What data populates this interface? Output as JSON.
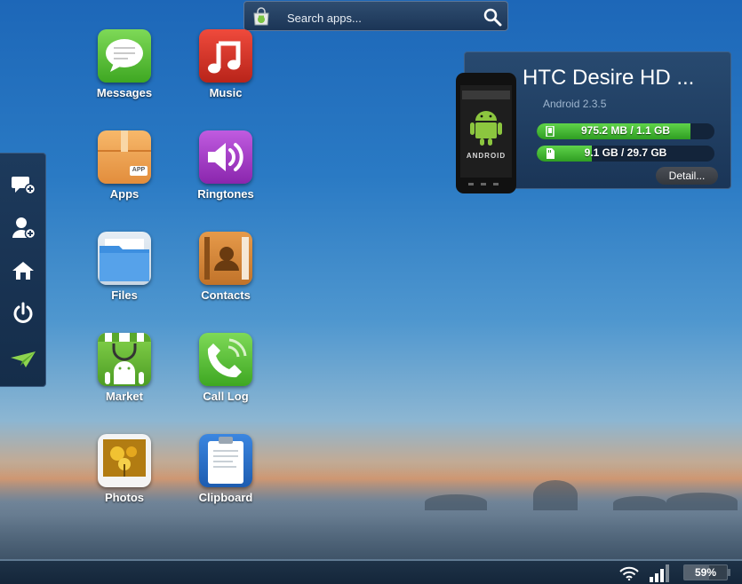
{
  "search": {
    "placeholder": "Search apps..."
  },
  "toolbar": {
    "items": [
      {
        "icon": "new-message-icon"
      },
      {
        "icon": "add-contact-icon"
      },
      {
        "icon": "home-icon"
      },
      {
        "icon": "power-icon"
      },
      {
        "icon": "paper-plane-icon"
      }
    ]
  },
  "apps": [
    {
      "label": "Messages",
      "icon": "messages-icon",
      "color": "#5cc43b"
    },
    {
      "label": "Music",
      "icon": "music-icon",
      "color": "#d8362b"
    },
    {
      "label": "Apps",
      "icon": "apps-icon",
      "color": "#f0a55a",
      "badge": "APP"
    },
    {
      "label": "Ringtones",
      "icon": "ringtones-icon",
      "color": "#a640c9"
    },
    {
      "label": "Files",
      "icon": "files-icon",
      "color": "#3d8fe0"
    },
    {
      "label": "Contacts",
      "icon": "contacts-icon",
      "color": "#d88a3a"
    },
    {
      "label": "Market",
      "icon": "market-icon",
      "color": "#6cc033"
    },
    {
      "label": "Call Log",
      "icon": "call-log-icon",
      "color": "#5cc43b"
    },
    {
      "label": "Photos",
      "icon": "photos-icon",
      "color": "#f4f4f4"
    },
    {
      "label": "Clipboard",
      "icon": "clipboard-icon",
      "color": "#2a72d0"
    }
  ],
  "device": {
    "name": "HTC Desire HD ...",
    "os": "Android 2.3.5",
    "phone_logo": "ANDROID",
    "storage": [
      {
        "text": "975.2 MB / 1.1 GB",
        "fraction": 0.865,
        "icon": "phone-storage-icon"
      },
      {
        "text": "9.1 GB / 29.7 GB",
        "fraction": 0.31,
        "icon": "sd-card-icon"
      }
    ],
    "detail_label": "Detail..."
  },
  "status": {
    "battery_percent": "59%",
    "battery_fraction": 0.59
  }
}
